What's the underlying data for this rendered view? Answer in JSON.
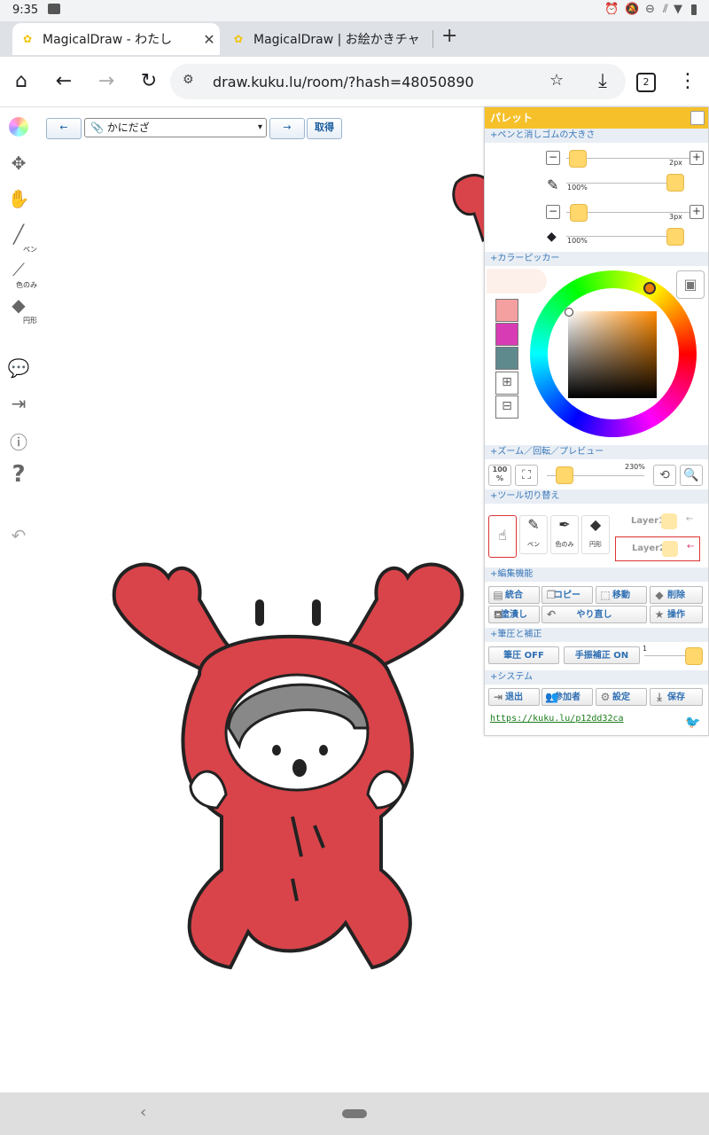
{
  "status_bar": {
    "time": "9:35"
  },
  "tabs": [
    {
      "title": "MagicalDraw - わたし",
      "active": true
    },
    {
      "title": "MagicalDraw | お絵かきチャ",
      "active": false
    }
  ],
  "omnibox": {
    "url": "draw.kuku.lu/room/?hash=48050890",
    "tab_count": "2"
  },
  "canvas_controls": {
    "prev_label": "←",
    "select_value": "📎 かにだざ",
    "next_label": "→",
    "get_label": "取得"
  },
  "left_toolbar": {
    "pen_label": "ペン",
    "eyedropper_label": "色のみ",
    "eraser_label": "円形"
  },
  "palette": {
    "title": "パレット",
    "sections": {
      "pen_size": "+ペンと消しゴムの大きさ",
      "color_picker": "+カラーピッカー",
      "zoom": "+ズーム／回転／プレビュー",
      "tool_switch": "+ツール切り替え",
      "edit": "+編集機能",
      "pressure": "+筆圧と補正",
      "system": "+システム"
    },
    "pen": {
      "size": "2px",
      "opacity": "100%"
    },
    "eraser": {
      "size": "3px",
      "opacity": "100%"
    },
    "swatches": [
      "#f4a0a0",
      "#d83cb4",
      "#5e8a8e"
    ],
    "zoom": {
      "reset_label": "100 %",
      "value": "230%"
    },
    "tools": {
      "pen_label": "ペン",
      "eyedropper_label": "色のみ",
      "eraser_label": "円形"
    },
    "layers": [
      "Layer1",
      "Layer2"
    ],
    "edit_buttons": [
      "統合",
      "コピー",
      "移動",
      "削除",
      "塗潰し",
      "やり直し",
      "操作"
    ],
    "pressure": {
      "pressure_btn": "筆圧 OFF",
      "stabilize_btn": "手振補正 ON",
      "stabilize_value": "1"
    },
    "system_buttons": [
      "退出",
      "参加者",
      "設定",
      "保存"
    ],
    "link": "https://kuku.lu/p12dd32ca"
  },
  "colors": {
    "accent": "#f5c02a",
    "crab": "#d8444a",
    "link": "#1a7a1a"
  }
}
